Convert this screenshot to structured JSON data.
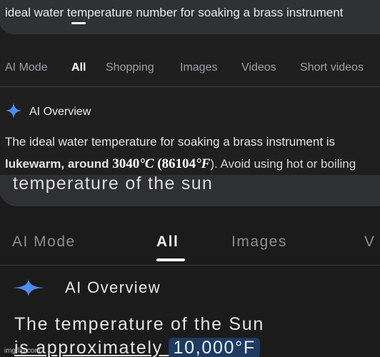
{
  "top": {
    "query": "ideal water temperature number for soaking a brass instrument",
    "tabs": [
      "AI Mode",
      "All",
      "Shopping",
      "Images",
      "Videos",
      "Short videos"
    ],
    "active_tab": "All",
    "overview_label": "AI Overview",
    "answer_line1": "The ideal water temperature for soaking a brass instrument is",
    "answer_line2_bold": "lukewarm, around",
    "answer_value_c": "3040",
    "answer_unit_c": "°C",
    "answer_value_f": "(86104",
    "answer_unit_f": "°F",
    "answer_line2_tail": "). Avoid using hot or boiling"
  },
  "bottom": {
    "query": "temperature of the sun",
    "tabs": [
      "AI Mode",
      "All",
      "Images",
      "V"
    ],
    "active_tab": "All",
    "overview_label": "AI Overview",
    "answer_line1": "The temperature of the Sun",
    "answer_line2": "is approximately",
    "answer_highlight": "10,000°F"
  },
  "watermark": "imgflip.com",
  "colors": {
    "spark_blue": "#4c8df6",
    "highlight_bg": "#1e3a5f",
    "page_bg": "#1f1f1f"
  },
  "icons": [
    "sparkle-icon"
  ]
}
